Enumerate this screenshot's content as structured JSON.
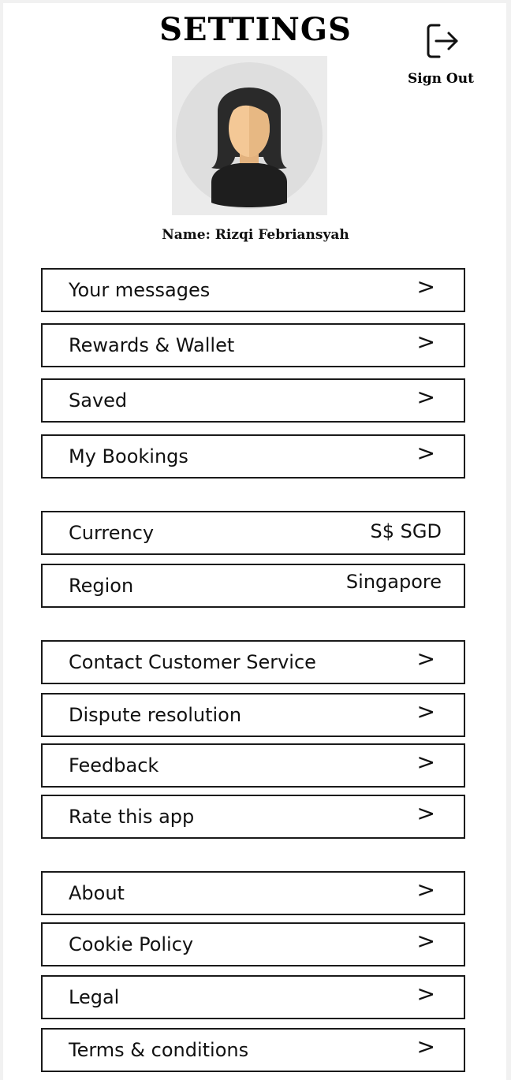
{
  "header": {
    "title": "SETTINGS",
    "sign_out_label": "Sign Out",
    "sign_out_icon": "sign-out-icon"
  },
  "profile": {
    "avatar_icon": "female-user-avatar",
    "name": "Name: Rizqi Febriansyah"
  },
  "account": [
    {
      "label": "Your messages",
      "chevron": ">"
    },
    {
      "label": "Rewards & Wallet",
      "chevron": ">"
    },
    {
      "label": "Saved",
      "chevron": ">"
    },
    {
      "label": "My Bookings",
      "chevron": ">"
    }
  ],
  "preferences": [
    {
      "label": "Currency",
      "value": "S$ SGD"
    },
    {
      "label": "Region",
      "value": "Singapore"
    }
  ],
  "support": [
    {
      "label": "Contact Customer Service",
      "chevron": ">"
    },
    {
      "label": "Dispute resolution",
      "chevron": ">"
    },
    {
      "label": "Feedback",
      "chevron": ">"
    },
    {
      "label": "Rate this app",
      "chevron": ">"
    }
  ],
  "info": [
    {
      "label": "About",
      "chevron": ">"
    },
    {
      "label": "Cookie Policy",
      "chevron": ">"
    },
    {
      "label": "Legal",
      "chevron": ">"
    },
    {
      "label": "Terms & conditions",
      "chevron": ">"
    }
  ]
}
